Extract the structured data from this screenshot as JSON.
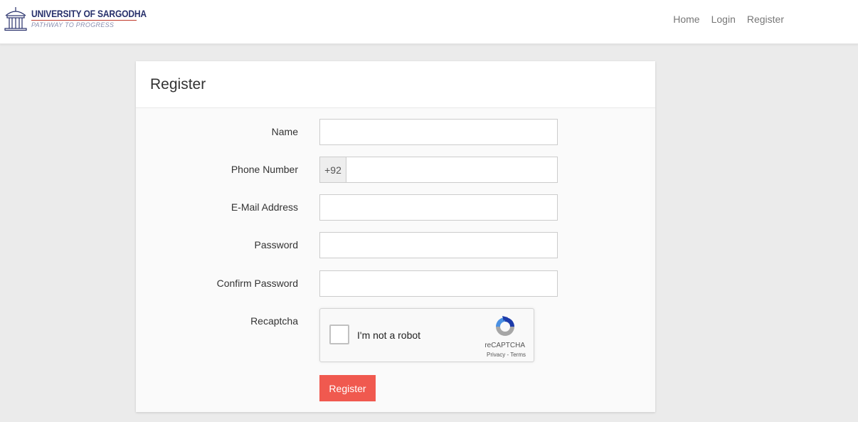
{
  "navbar": {
    "brand_name": "UNIVERSITY OF SARGODHA",
    "brand_tagline": "PATHWAY TO PROGRESS",
    "links": [
      "Home",
      "Login",
      "Register"
    ]
  },
  "card": {
    "title": "Register",
    "fields": {
      "name": {
        "label": "Name",
        "value": "",
        "placeholder": ""
      },
      "phone": {
        "label": "Phone Number",
        "prefix": "+92",
        "value": "",
        "placeholder": ""
      },
      "email": {
        "label": "E-Mail Address",
        "value": "",
        "placeholder": ""
      },
      "password": {
        "label": "Password",
        "value": "",
        "placeholder": ""
      },
      "confirm_password": {
        "label": "Confirm Password",
        "value": "",
        "placeholder": ""
      }
    },
    "recaptcha": {
      "label": "Recaptcha",
      "checkbox_text": "I'm not a robot",
      "brand": "reCAPTCHA",
      "privacy": "Privacy",
      "separator": " - ",
      "terms": "Terms"
    },
    "submit_label": "Register"
  },
  "colors": {
    "brand_navy": "#27306b",
    "submit_button": "#f0594f",
    "page_background": "#ebebeb"
  }
}
